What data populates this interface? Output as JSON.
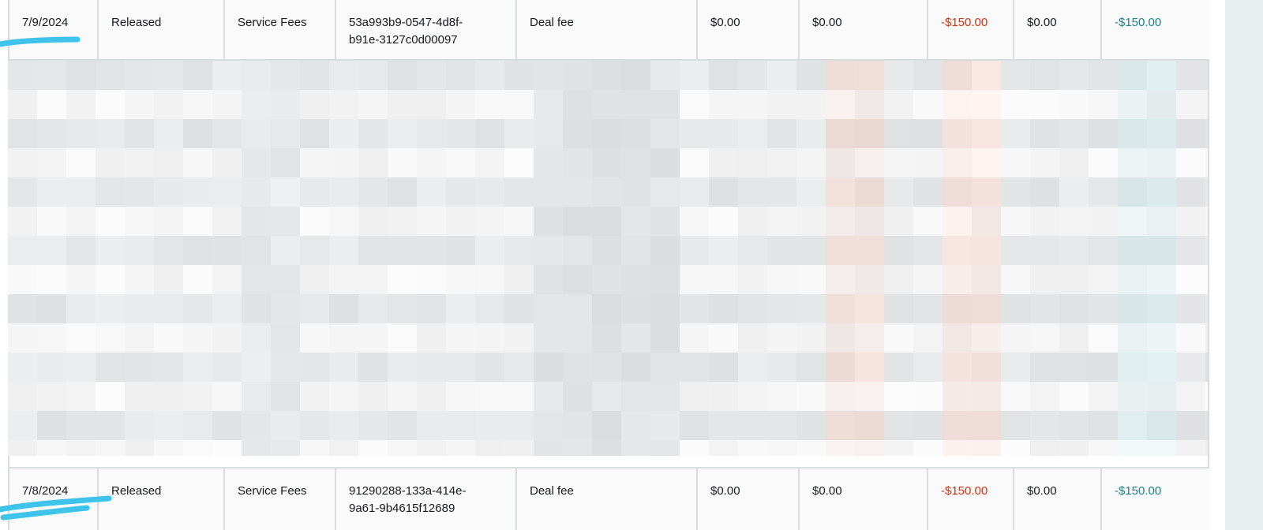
{
  "table": {
    "rows": [
      {
        "date": "7/9/2024",
        "status": "Released",
        "type": "Service Fees",
        "id_line1": "53a993b9-0547-4d8f-",
        "id_line2": "b91e-3127c0d00097",
        "description": "Deal fee",
        "amount1": "$0.00",
        "amount2": "$0.00",
        "amount3": "-$150.00",
        "amount4": "$0.00",
        "total": "-$150.00"
      },
      {
        "date": "7/8/2024",
        "status": "Released",
        "type": "Service Fees",
        "id_line1": "91290288-133a-414e-",
        "id_line2": "9a61-9b4615f12689",
        "description": "Deal fee",
        "amount1": "$0.00",
        "amount2": "$0.00",
        "amount3": "-$150.00",
        "amount4": "$0.00",
        "total": "-$150.00"
      }
    ],
    "redacted_section": "pixelated rows"
  },
  "colors": {
    "border": "#d9dcdd",
    "text": "#16191f",
    "negative_red": "#d13212",
    "negative_teal": "#1b8185",
    "scribble": "#3ec3ea",
    "side_panel": "#e6eeee"
  }
}
